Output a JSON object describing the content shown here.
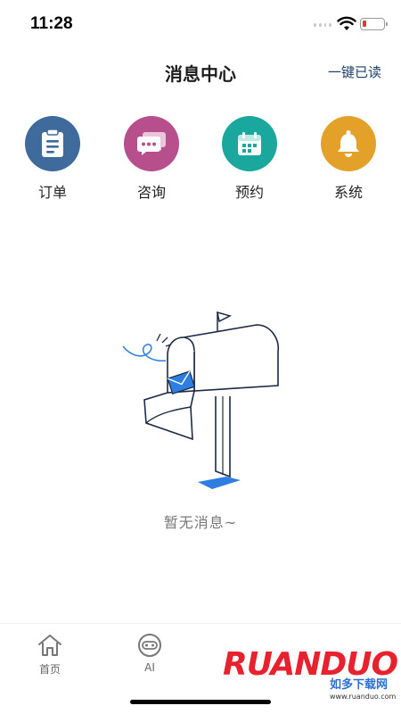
{
  "status_bar": {
    "time": "11:28"
  },
  "header": {
    "title": "消息中心",
    "mark_all_read": "一键已读"
  },
  "categories": [
    {
      "label": "订单",
      "icon": "clipboard-icon",
      "color": "#3f6a9c"
    },
    {
      "label": "咨询",
      "icon": "chat-bubbles-icon",
      "color": "#b74f8c"
    },
    {
      "label": "预约",
      "icon": "calendar-icon",
      "color": "#1aa89e"
    },
    {
      "label": "系统",
      "icon": "bell-icon",
      "color": "#e3a12a"
    }
  ],
  "empty_state": {
    "message": "暂无消息~"
  },
  "tab_bar": {
    "tabs": [
      {
        "label": "首页",
        "icon": "home-icon"
      },
      {
        "label": "AI",
        "icon": "robot-icon"
      }
    ]
  },
  "watermark": {
    "brand": "RUANDUO",
    "sub": "如多下载网",
    "url": "www.ruanduo.com"
  },
  "colors": {
    "accent_link": "#1d3f6b",
    "battery_low": "#e53935"
  }
}
